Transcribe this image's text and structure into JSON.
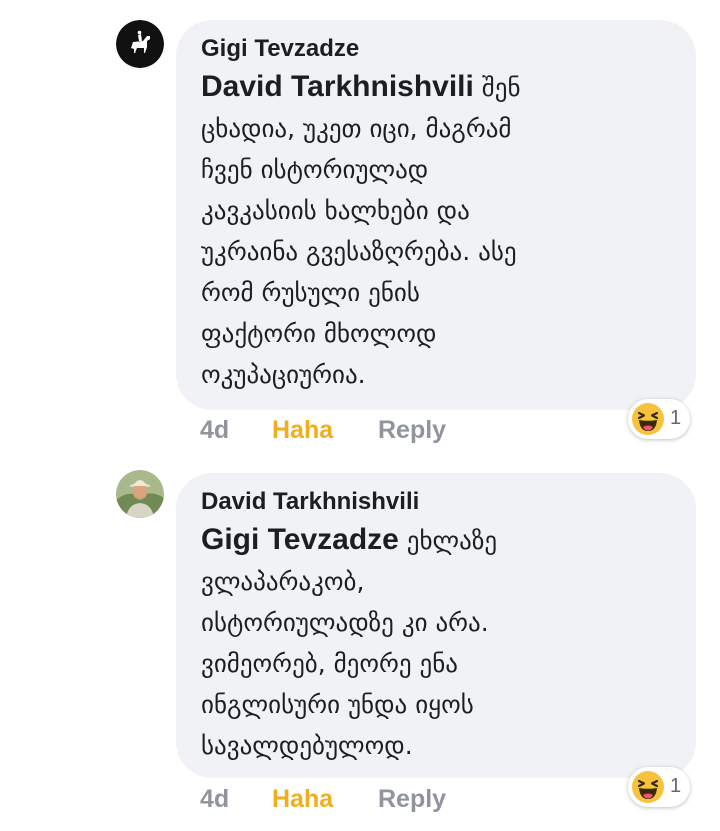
{
  "comments": [
    {
      "author": "Gigi Tevzadze",
      "mention": "David Tarkhnishvili",
      "lines": [
        " შენ",
        "ცხადია, უკეთ იცი, მაგრამ",
        "ჩვენ ისტორიულად",
        "კავკასიის ხალხები და",
        "უკრაინა გვესაზღრება. ასე",
        "რომ რუსული ენის",
        "ფაქტორი მხოლოდ",
        "ოკუპაციურია."
      ],
      "time": "4d",
      "reaction_label": "Haha",
      "reply_label": "Reply",
      "reaction_count": "1",
      "reaction_icon": "haha-emoji-icon",
      "avatar_icon": "horse-rider-icon"
    },
    {
      "author": "David Tarkhnishvili",
      "mention": "Gigi Tevzadze",
      "lines": [
        " ეხლაზე",
        "ვლაპარაკობ,",
        "ისტორიულადზე კი არა.",
        "ვიმეორებ, მეორე ენა",
        "ინგლისური უნდა იყოს",
        "სავალდებულოდ."
      ],
      "time": "4d",
      "reaction_label": "Haha",
      "reply_label": "Reply",
      "reaction_count": "1",
      "reaction_icon": "haha-emoji-icon",
      "avatar_icon": "user-photo"
    }
  ],
  "colors": {
    "bubble": "#f0f2f5",
    "text": "#1c1e21",
    "muted": "#90949c",
    "haha": "#f0ad1d"
  }
}
